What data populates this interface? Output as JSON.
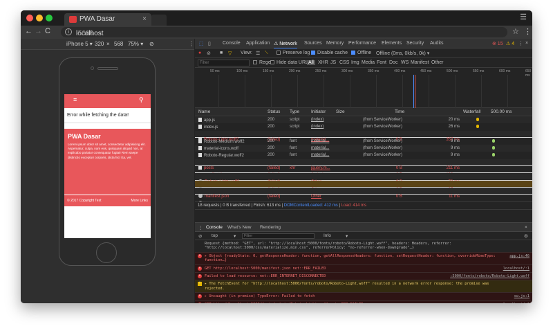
{
  "browser": {
    "tab_title": "PWA Dasar",
    "tab_close": "×",
    "url_host": "localhost",
    "url_port": ":5000",
    "colors": {
      "red": "#ff5f57",
      "yellow": "#febc2e",
      "green": "#28c840"
    }
  },
  "device": {
    "model": "iPhone 5 ▾",
    "width": "320",
    "times": "×",
    "height": "568",
    "zoom": "75% ▾"
  },
  "app": {
    "error_text": "Error while fetching the data!",
    "hero_title": "PWA Dasar",
    "hero_body": "Lorem ipsum dolor sit amet, consectetur adipisicing elit. Aspernatur, culpa, nam eos, quisquam aliquid non, at explicabo pariatur consequatur fugiat! Rem saepe distinctio excepturi corporis, dicta hic! Ea, vel.",
    "footer_copy": "© 2017 Copyright Text",
    "footer_more": "More Links"
  },
  "devtools": {
    "tabs": [
      "Console",
      "Application",
      "⚠ Network",
      "Sources",
      "Memory",
      "Performance",
      "Elements",
      "Security",
      "Audits"
    ],
    "errors": "⊗ 15",
    "warnings": "⚠ 4",
    "toolbar": {
      "view": "View:",
      "preserve_log": "Preserve log",
      "disable_cache": "Disable cache",
      "offline": "Offline",
      "throttle": "Offline (0ms, 0kb/s, 0k) ▾"
    },
    "filter": {
      "placeholder": "Filter",
      "regex": "Regex",
      "hide_data": "Hide data URLs",
      "types": [
        "All",
        "XHR",
        "JS",
        "CSS",
        "Img",
        "Media",
        "Font",
        "Doc",
        "WS",
        "Manifest",
        "Other"
      ]
    },
    "timeline_ticks": [
      "50 ms",
      "100 ms",
      "150 ms",
      "200 ms",
      "250 ms",
      "300 ms",
      "350 ms",
      "400 ms",
      "450 ms",
      "500 ms",
      "550 ms",
      "600 ms",
      "650 ms",
      "700 ms",
      "750 ms",
      "800 m"
    ],
    "columns": {
      "name": "Name",
      "status": "Status",
      "type": "Type",
      "initiator": "Initiator",
      "size": "Size",
      "time": "Time",
      "waterfall": "Waterfall",
      "waterfall_scale": "500.00 ms"
    },
    "requests": [
      {
        "name": "app.js",
        "status": "200",
        "type": "script",
        "initiator": "(index)",
        "size": "(from ServiceWorker)",
        "time": "20 ms",
        "err": false
      },
      {
        "name": "index.js",
        "status": "200",
        "type": "script",
        "initiator": "(index)",
        "size": "(from ServiceWorker)",
        "time": "26 ms",
        "err": false
      },
      {
        "name": "Roboto-Light.woff2",
        "status": "(failed)",
        "type": "",
        "initiator": "material...",
        "size": "0 B",
        "time": "357 ms",
        "err": true
      },
      {
        "name": "Roboto-Medium.woff2",
        "status": "200",
        "type": "font",
        "initiator": "material...",
        "size": "(from ServiceWorker)",
        "time": "9 ms",
        "err": false
      },
      {
        "name": "material-icons.woff",
        "status": "200",
        "type": "font",
        "initiator": "material...",
        "size": "(from ServiceWorker)",
        "time": "9 ms",
        "err": false
      },
      {
        "name": "Roboto-Regular.woff2",
        "status": "200",
        "type": "font",
        "initiator": "material...",
        "size": "(from ServiceWorker)",
        "time": "9 ms",
        "err": false
      },
      {
        "name": "posts",
        "status": "(failed)",
        "type": "xhr",
        "initiator": "jquery.m...",
        "size": "0 B",
        "time": "211 ms",
        "err": true
      },
      {
        "name": "manifest.json",
        "status": "(failed)",
        "type": "",
        "initiator": "(index)",
        "size": "0 B",
        "time": "126 ms",
        "err": true
      },
      {
        "name": "Roboto-Light.woff2",
        "status": "(failed)",
        "type": "",
        "initiator": "Other",
        "size": "0 B",
        "time": "70 ms",
        "err": true
      },
      {
        "name": "posts",
        "status": "(failed)",
        "type": "",
        "initiator": "Other",
        "size": "0 B",
        "time": "37 ms",
        "err": true
      },
      {
        "name": "manifest.json",
        "status": "(failed)",
        "type": "",
        "initiator": "Other",
        "size": "0 B",
        "time": "11 ms",
        "err": true
      },
      {
        "name": "Roboto-Light.woff",
        "status": "(failed)",
        "type": "",
        "initiator": "(index)",
        "size": "0 B",
        "time": "74 ms",
        "err": true
      },
      {
        "name": "Roboto-Light.woff",
        "status": "(failed)",
        "type": "",
        "initiator": "Other",
        "size": "0 B",
        "time": "11 ms",
        "err": true
      }
    ],
    "summary_a": "18 requests | 0 B transferred | Finish: 613 ms | ",
    "summary_dcl": "DOMContentLoaded: 412 ms",
    "summary_sep": " | ",
    "summary_load": "Load: 414 ms",
    "drawer_tabs": [
      "Console",
      "What's New",
      "Rendering"
    ],
    "drawer_close": "×",
    "console": {
      "context": "top",
      "filter_placeholder": "Filter",
      "level": "Info"
    },
    "logs": [
      {
        "kind": "plain",
        "text": "Request {method: \"GET\", url: \"http://localhost:5000/fonts/roboto/Roboto-Light.woff\", headers: Headers, referrer: \"http://localhost:5000/css/materialize.min.css\", referrerPolicy: \"no-referrer-when-downgrade\"…}",
        "src": ""
      },
      {
        "kind": "e",
        "text": "▸ Object {readyState: 0, getResponseHeader: function, getAllResponseHeaders: function, setRequestHeader: function, overrideMimeType: function…}",
        "src": "app.js:46"
      },
      {
        "kind": "e",
        "text": "GET http://localhost:5000/manifest.json net::ERR_FAILED",
        "src": "localhost/:1"
      },
      {
        "kind": "e",
        "text": "Failed to load resource: net::ERR_INTERNET_DISCONNECTED",
        "src": ":5000/fonts/roboto/Roboto-Light.woff"
      },
      {
        "kind": "w",
        "text": "▸ The FetchEvent for \"http://localhost:5000/fonts/roboto/Roboto-Light.woff\" resulted in a network error response: the promise was rejected.",
        "src": ""
      },
      {
        "kind": "e",
        "text": "▸ Uncaught (in promise) TypeError: Failed to fetch",
        "src": "sw.js:1"
      },
      {
        "kind": "e",
        "text": "GET http://localhost:5000/fonts/roboto/Roboto-Light.woff net::ERR_FAILED",
        "src": "localhost/:1"
      }
    ],
    "prompt": ">"
  }
}
